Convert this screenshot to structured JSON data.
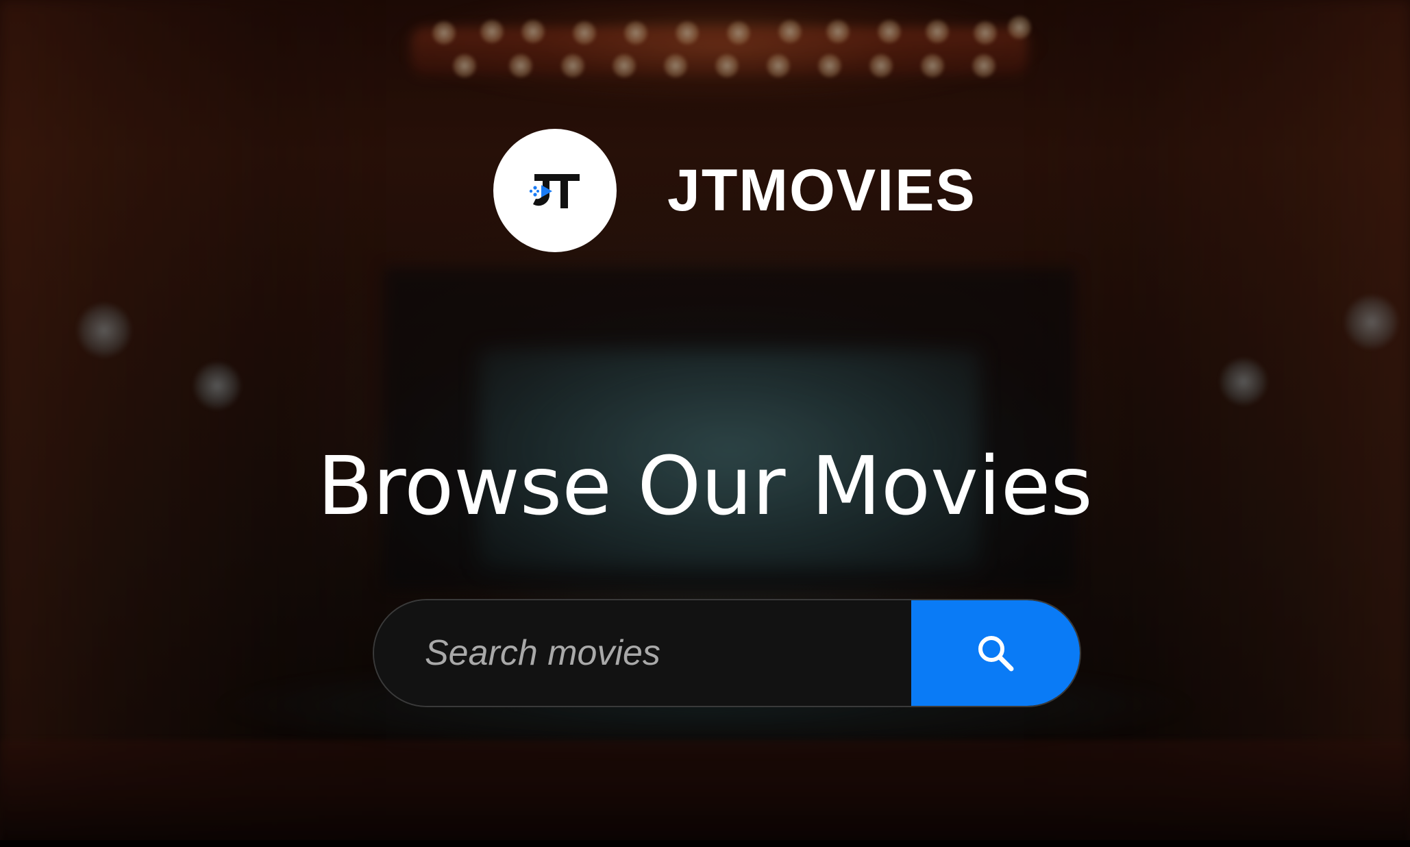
{
  "brand": {
    "logo_text": "JT",
    "name": "JTMOVIES"
  },
  "hero": {
    "title": "Browse Our Movies"
  },
  "search": {
    "placeholder": "Search movies",
    "value": "",
    "button_icon": "search-icon"
  },
  "colors": {
    "accent": "#0a7bf6",
    "search_field_bg": "#121212",
    "text": "#ffffff"
  }
}
